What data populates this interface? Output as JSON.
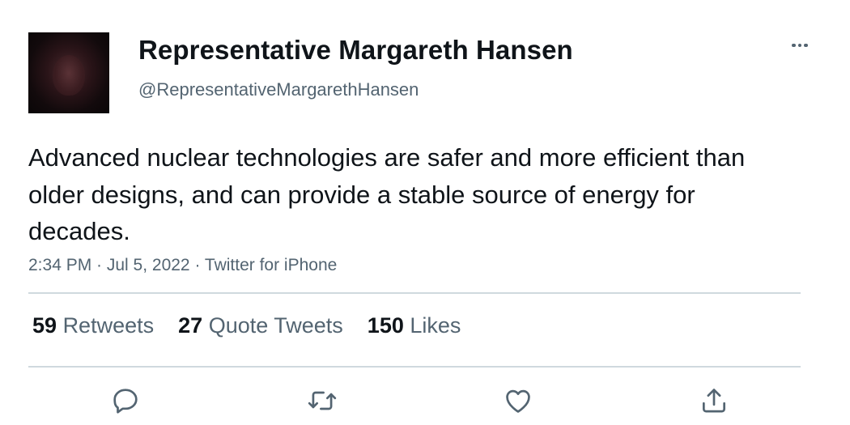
{
  "author": {
    "display_name": "Representative Margareth Hansen",
    "handle": "@RepresentativeMargarethHansen"
  },
  "tweet": {
    "text": "Advanced nuclear technologies are safer and more efficient than older designs, and can provide a stable source of energy for decades.",
    "meta": "2:34 PM · Jul 5, 2022 · Twitter for iPhone"
  },
  "stats": {
    "retweets_count": "59",
    "retweets_label": "Retweets",
    "quotes_count": "27",
    "quotes_label": "Quote Tweets",
    "likes_count": "150",
    "likes_label": "Likes"
  },
  "icons": {
    "more": "more-icon",
    "reply": "reply-icon",
    "retweet": "retweet-icon",
    "like": "like-icon",
    "share": "share-icon"
  },
  "colors": {
    "text_primary": "#0f1419",
    "text_secondary": "#536471",
    "divider": "#cfd9de"
  }
}
